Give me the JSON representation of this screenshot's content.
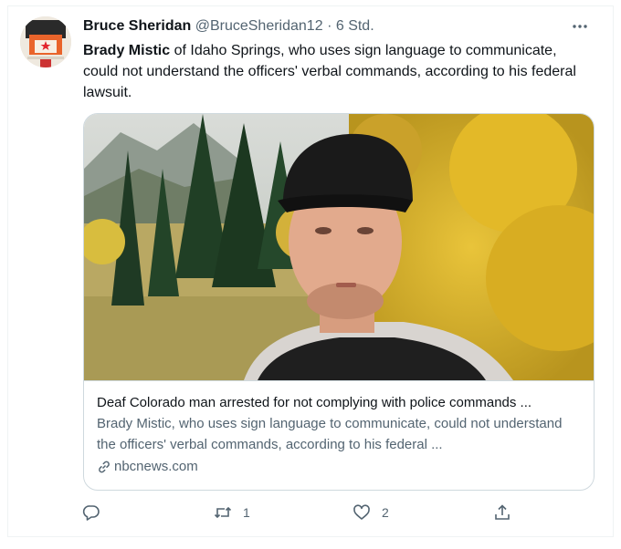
{
  "author": {
    "name": "Bruce Sheridan",
    "handle": "@BruceSheridan12",
    "separator": "·",
    "time": "6 Std."
  },
  "tweet": {
    "mention": "Brady Mistic",
    "text": " of Idaho Springs, who uses sign language to communicate, could not understand the officers' verbal commands, according to his federal lawsuit."
  },
  "card": {
    "title": "Deaf Colorado man arrested for not complying with police commands ...",
    "description": "Brady Mistic, who uses sign language to communicate, could not understand the officers' verbal commands, according to his federal ...",
    "domain": "nbcnews.com"
  },
  "actions": {
    "reply_count": "",
    "retweet_count": "1",
    "like_count": "2"
  },
  "icons": {
    "more": "more-icon",
    "reply": "reply-icon",
    "retweet": "retweet-icon",
    "like": "like-icon",
    "share": "share-icon",
    "link": "link-icon"
  },
  "colors": {
    "text_primary": "#0f1419",
    "text_secondary": "#536471",
    "border": "#cfd9de"
  }
}
